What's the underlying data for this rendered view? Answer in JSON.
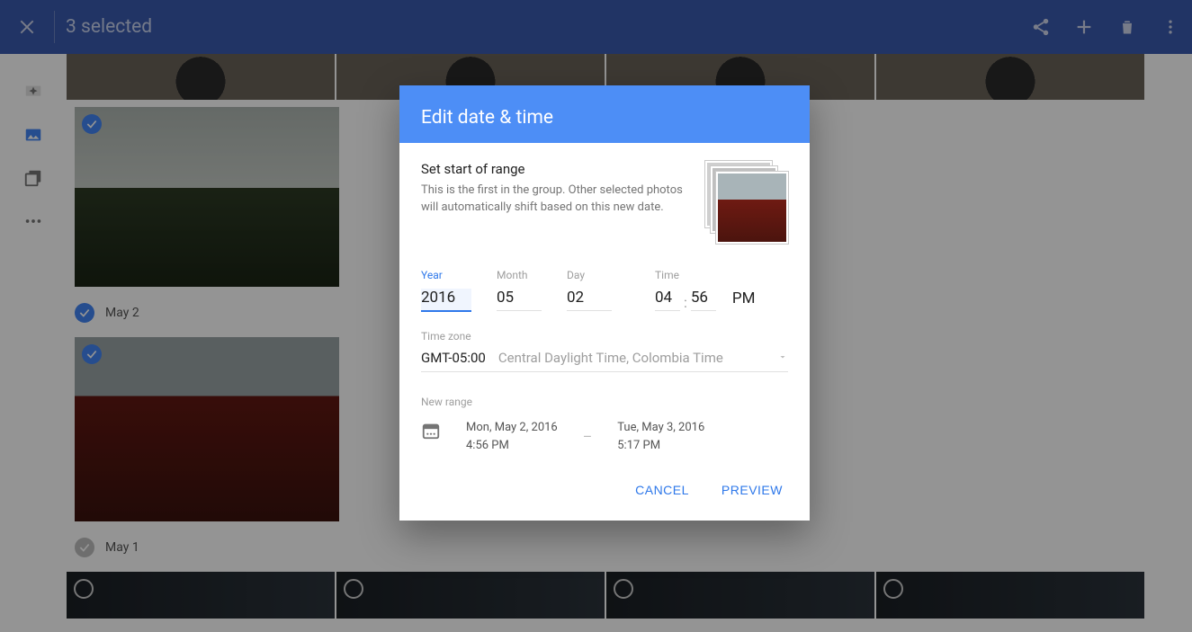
{
  "appbar": {
    "title": "3 selected"
  },
  "sections": {
    "may2_label": "May 2",
    "may1_label": "May 1"
  },
  "dialog": {
    "title": "Edit date & time",
    "subtitle": "Set start of range",
    "description": "This is the first in the group. Other selected photos will automatically shift based on this new date.",
    "fields": {
      "year_label": "Year",
      "year_value": "2016",
      "month_label": "Month",
      "month_value": "05",
      "day_label": "Day",
      "day_value": "02",
      "time_label": "Time",
      "time_hour": "04",
      "time_minute": "56",
      "time_period": "PM"
    },
    "timezone": {
      "label": "Time zone",
      "gmt": "GMT-05:00",
      "name": "Central Daylight Time, Colombia Time"
    },
    "new_range": {
      "label": "New range",
      "start_date": "Mon, May 2, 2016",
      "start_time": "4:56 PM",
      "end_date": "Tue, May 3, 2016",
      "end_time": "5:17 PM"
    },
    "actions": {
      "cancel": "CANCEL",
      "preview": "PREVIEW"
    }
  }
}
